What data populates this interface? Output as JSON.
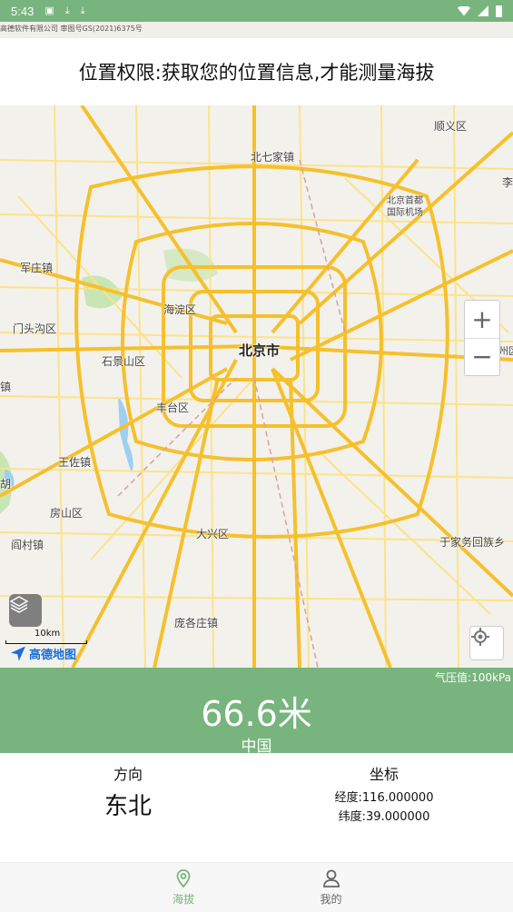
{
  "status_bar": {
    "time": "5:43",
    "icons": [
      "notification-a-icon",
      "download-icon",
      "download-icon",
      "wifi-icon",
      "signal-icon",
      "battery-icon"
    ]
  },
  "map_strip_text": "高德软件有限公司 审图号GS(2021)6375号",
  "banner": {
    "text": "位置权限:获取您的位置信息,才能测量海拔"
  },
  "map": {
    "labels": {
      "beijing": "北京市",
      "shunyi": "顺义区",
      "beiqijia": "北七家镇",
      "airport1": "北京首都",
      "airport2": "国际机场",
      "junzhuang": "军庄镇",
      "haidian": "海淀区",
      "mentougou": "门头沟区",
      "shijingshan": "石景山区",
      "fengtai": "丰台区",
      "zhen": "镇",
      "wangzuo": "王佐镇",
      "hu": "胡",
      "fangshan": "房山区",
      "yancun": "阎村镇",
      "daxing": "大兴区",
      "yujiawu": "于家务回族乡",
      "pangezhuang": "庞各庄镇",
      "li": "李",
      "tongzhou": "通州区"
    },
    "zoom_in": "+",
    "zoom_out": "−",
    "scale": "10km",
    "logo": "高德地图",
    "colors": {
      "background": "#f3f1ec",
      "highway": "#f5c02c",
      "road": "#fbe38a",
      "water": "#9fcff0",
      "green": "#c8e6b4"
    }
  },
  "altitude_panel": {
    "pressure": "气压值:100kPa",
    "altitude": "66.6米",
    "region": "中国",
    "color": "#78b47d"
  },
  "info": {
    "direction_title": "方向",
    "direction_value": "东北",
    "coord_title": "坐标",
    "longitude": "经度:116.000000",
    "latitude": "纬度:39.000000"
  },
  "bottom_nav": {
    "altitude_label": "海拔",
    "mine_label": "我的"
  }
}
